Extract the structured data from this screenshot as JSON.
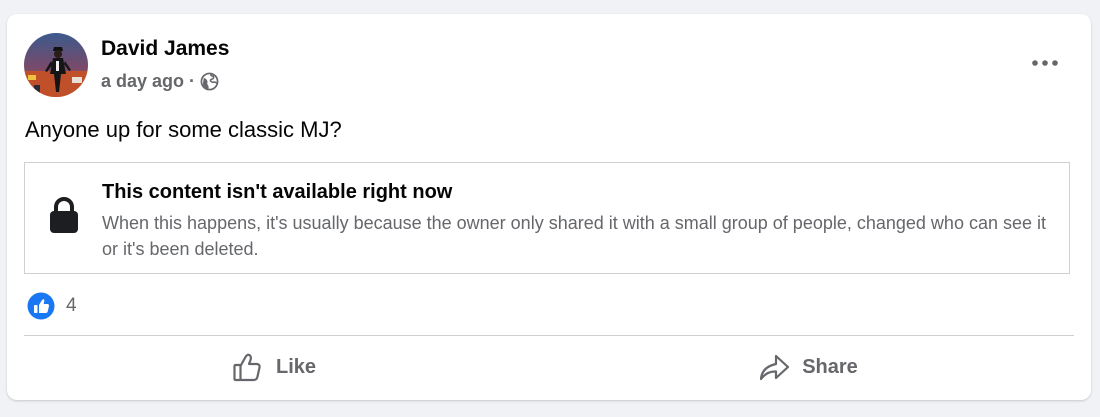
{
  "post": {
    "author": "David James",
    "timestamp": "a day ago",
    "separator": "·",
    "audience_icon": "globe-icon",
    "text": "Anyone up for some classic MJ?",
    "more_icon": "more-horizontal-icon",
    "avatar_icon": "profile-photo-avatar"
  },
  "unavailable": {
    "icon": "lock-icon",
    "title": "This content isn't available right now",
    "body": "When this happens, it's usually because the owner only shared it with a small group of people, changed who can see it or it's been deleted."
  },
  "reactions": {
    "icon": "like-reaction-icon",
    "count": "4"
  },
  "actions": {
    "like_label": "Like",
    "like_icon": "thumbs-up-icon",
    "share_label": "Share",
    "share_icon": "share-arrow-icon"
  },
  "colors": {
    "page_background": "#f0f2f5",
    "card_background": "#ffffff",
    "primary_text": "#050505",
    "secondary_text": "#65676b",
    "divider": "#ced0d4",
    "like_blue": "#1877f2"
  }
}
